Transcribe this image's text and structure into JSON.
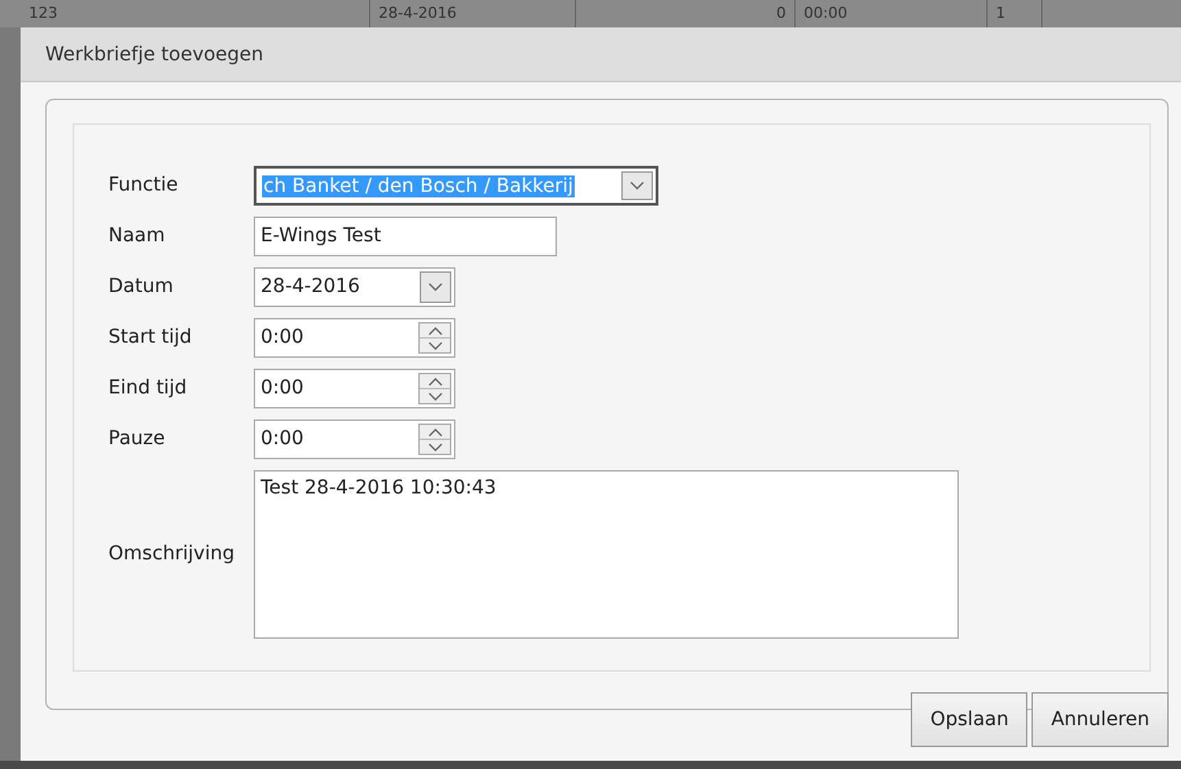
{
  "background_row": [
    "123",
    "28-4-2016",
    "0",
    "00:00",
    "1"
  ],
  "dialog": {
    "title": "Werkbriefje toevoegen"
  },
  "fields": [
    {
      "label": "Functie",
      "kind": "select",
      "value": "ch Banket / den Bosch / Bakkerij",
      "highlighted": true
    },
    {
      "label": "Naam",
      "kind": "text",
      "value": "E-Wings Test"
    },
    {
      "label": "Datum",
      "kind": "date",
      "value": "28-4-2016"
    },
    {
      "label": "Start tijd",
      "kind": "time",
      "value": "0:00"
    },
    {
      "label": "Eind tijd",
      "kind": "time",
      "value": "0:00"
    },
    {
      "label": "Pauze",
      "kind": "time",
      "value": "0:00"
    },
    {
      "label": "Omschrijving",
      "kind": "textarea",
      "value": "Test 28-4-2016 10:30:43"
    }
  ],
  "buttons": [
    "Opslaan",
    "Annuleren"
  ]
}
